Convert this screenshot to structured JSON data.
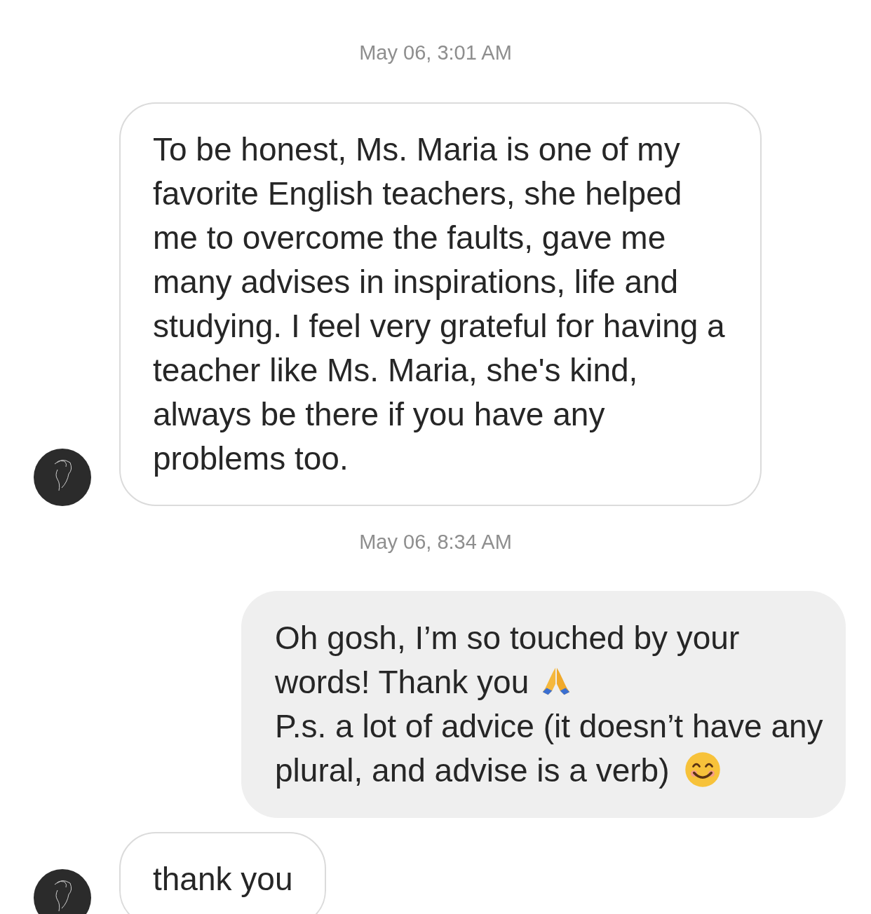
{
  "messages": [
    {
      "kind": "timestamp",
      "text": "May 06, 3:01 AM"
    },
    {
      "kind": "incoming",
      "avatar": true,
      "paragraphs": [
        {
          "text": "To be honest, Ms. Maria is one of my favorite English teachers, she helped me to overcome the faults, gave me many advises in inspirations, life and studying. I feel very grateful for having a teacher like Ms. Maria, she's kind, always be there if you have any problems too."
        }
      ]
    },
    {
      "kind": "timestamp",
      "text": "May 06, 8:34 AM"
    },
    {
      "kind": "outgoing",
      "paragraphs": [
        {
          "text": "Oh gosh, I’m so touched by your words! Thank you",
          "kind": "prayer"
        },
        {
          "text": "P.s. a lot of advice (it doesn’t have any plural, and advise is a verb)",
          "kind": "smile"
        }
      ]
    },
    {
      "kind": "incoming",
      "avatar": true,
      "paragraphs": [
        {
          "text": "thank you"
        }
      ]
    }
  ]
}
